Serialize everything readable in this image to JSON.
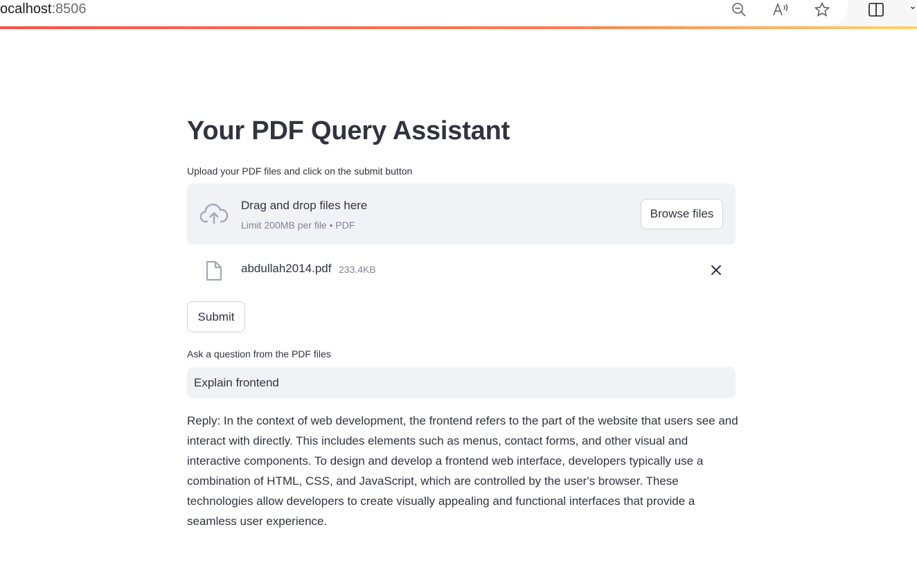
{
  "browser": {
    "url_host": "ocalhost",
    "url_port": ":8506",
    "icons": [
      "zoom-out-icon",
      "read-aloud-icon",
      "favorite-star-icon",
      "split-screen-icon"
    ]
  },
  "app": {
    "title": "Your PDF Query Assistant",
    "upload_label": "Upload your PDF files and click on the submit button",
    "dropzone": {
      "title": "Drag and drop files here",
      "subtitle": "Limit 200MB per file • PDF",
      "browse_label": "Browse files"
    },
    "file": {
      "name": "abdullah2014.pdf",
      "size": "233.4KB"
    },
    "submit_label": "Submit",
    "question_label": "Ask a question from the PDF files",
    "question_value": "Explain frontend",
    "reply": "Reply: In the context of web development, the frontend refers to the part of the website that users see and interact with directly. This includes elements such as menus, contact forms, and other visual and interactive components. To design and develop a frontend web interface, developers typically use a combination of HTML, CSS, and JavaScript, which are controlled by the user's browser. These technologies allow developers to create visually appealing and functional interfaces that provide a seamless user experience."
  },
  "colors": {
    "accent_gradient_start": "#ff4b4b",
    "accent_gradient_end": "#ffd46b",
    "text": "#31333f",
    "muted_text": "#808495",
    "input_bg": "#f0f2f6"
  }
}
